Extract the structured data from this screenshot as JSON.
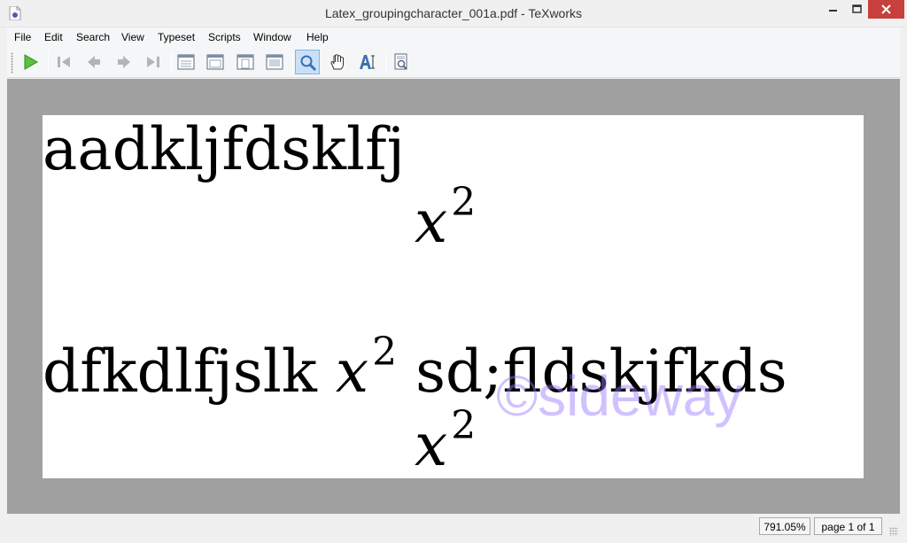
{
  "window": {
    "title": "Latex_groupingcharacter_001a.pdf - TeXworks",
    "close_color": "#c7403b"
  },
  "menu": {
    "items": [
      "File",
      "Edit",
      "Search",
      "View",
      "Typeset",
      "Scripts",
      "Window",
      "Help"
    ]
  },
  "toolbar": {
    "active_tool": "magnifier",
    "icons": [
      "typeset-play-icon",
      "first-page-icon",
      "previous-page-icon",
      "next-page-icon",
      "last-page-icon",
      "actual-size-icon",
      "fit-width-icon",
      "fit-page-icon",
      "fit-window-icon",
      "magnifier-icon",
      "hand-scroll-icon",
      "select-text-icon",
      "go-to-source-icon"
    ]
  },
  "document": {
    "line1": "aadkljfdsklfj",
    "math_var": "x",
    "math_exp": "2",
    "line2_before": "dfkdlfjslk",
    "line2_after": "sd;fldskjfkds",
    "watermark": "©sideway"
  },
  "status": {
    "zoom": "791.05%",
    "page": "page 1 of 1"
  }
}
